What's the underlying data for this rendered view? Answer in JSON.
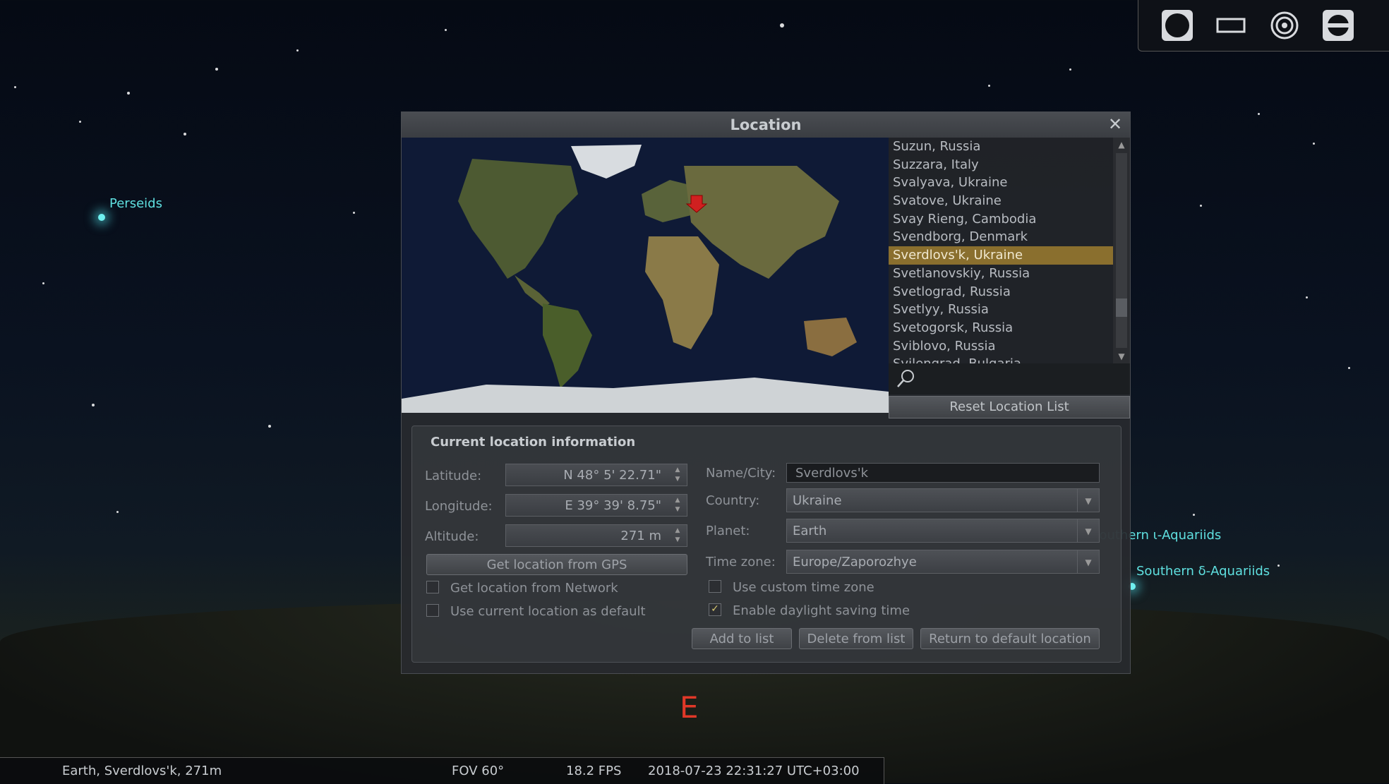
{
  "sky": {
    "meteor_showers": [
      {
        "label": "Perseids"
      },
      {
        "label": "Southern ι-Aquariids"
      },
      {
        "label": "Southern δ-Aquariids"
      }
    ],
    "compass": "E"
  },
  "toolbar": {
    "buttons": [
      {
        "icon": "circle-icon"
      },
      {
        "icon": "rectangle-icon"
      },
      {
        "icon": "target-icon"
      },
      {
        "icon": "wrench-icon"
      }
    ]
  },
  "dialog": {
    "title": "Location",
    "close": "✕",
    "location_list": [
      "Suzun, Russia",
      "Suzzara, Italy",
      "Svalyava, Ukraine",
      "Svatove, Ukraine",
      "Svay Rieng, Cambodia",
      "Svendborg, Denmark",
      "Svetlanovskiy, Russia",
      "Svetlograd, Russia",
      "Svetlyy, Russia",
      "Svetogorsk, Russia",
      "Sviblovo, Russia",
      "Svilengrad, Bulgaria"
    ],
    "selected_location": "Sverdlovs'k, Ukraine",
    "search_placeholder": "",
    "reset_button": "Reset Location List",
    "info": {
      "header": "Current location information",
      "latitude_label": "Latitude:",
      "latitude_value": "N 48° 5' 22.71\"",
      "longitude_label": "Longitude:",
      "longitude_value": "E 39° 39' 8.75\"",
      "altitude_label": "Altitude:",
      "altitude_value": "271 m",
      "gps_button": "Get location from GPS",
      "network_checkbox": "Get location from Network",
      "default_checkbox": "Use current location as default",
      "name_label": "Name/City:",
      "name_value": "Sverdlovs'k",
      "country_label": "Country:",
      "country_value": "Ukraine",
      "planet_label": "Planet:",
      "planet_value": "Earth",
      "timezone_label": "Time zone:",
      "timezone_value": "Europe/Zaporozhye",
      "custom_tz_checkbox": "Use custom time zone",
      "dst_checkbox": "Enable daylight saving time",
      "dst_checked": true,
      "add_button": "Add to list",
      "delete_button": "Delete from list",
      "return_button": "Return to default location"
    }
  },
  "statusbar": {
    "location": "Earth, Sverdlovs'k, 271m",
    "fov": "FOV 60°",
    "fps": "18.2 FPS",
    "datetime": "2018-07-23 22:31:27 UTC+03:00"
  },
  "colors": {
    "selection": "#8a6f2e",
    "meteor_label": "#5fe0e0",
    "compass": "#e03828"
  }
}
